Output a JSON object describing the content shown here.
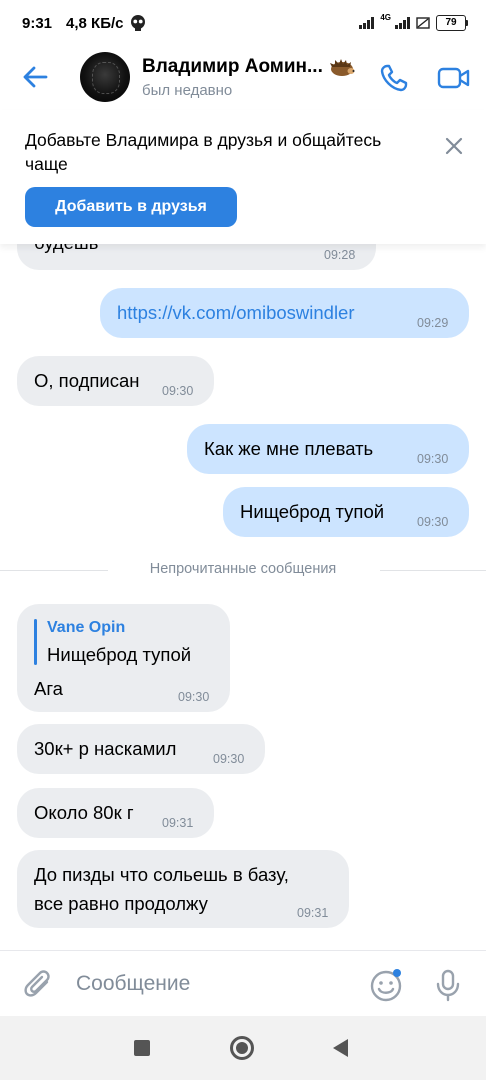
{
  "status_bar": {
    "time": "9:31",
    "speed": "4,8 КБ/с",
    "network": "4G",
    "battery": "79"
  },
  "header": {
    "contact_name": "Владимир Аомин...",
    "contact_status": "был недавно"
  },
  "friend_banner": {
    "text": "Добавьте Владимира в друзья и общайтесь чаще",
    "button_label": "Добавить в друзья"
  },
  "messages": [
    {
      "direction": "in",
      "text": "будешь",
      "time": "09:28"
    },
    {
      "direction": "out",
      "text": "https://vk.com/omiboswindler",
      "time": "09:29",
      "is_link": true
    },
    {
      "direction": "in",
      "text": "О, подписан",
      "time": "09:30"
    },
    {
      "direction": "out",
      "text": "Как же мне плевать",
      "time": "09:30"
    },
    {
      "direction": "out",
      "text": "Нищеброд тупой",
      "time": "09:30"
    }
  ],
  "unread_divider": "Непрочитанные сообщения",
  "unread_messages": [
    {
      "direction": "in",
      "reply_author": "Vane Opin",
      "reply_text": "Нищеброд тупой",
      "text": "Ага",
      "time": "09:30"
    },
    {
      "direction": "in",
      "text": "30к+ р наскамил",
      "time": "09:30"
    },
    {
      "direction": "in",
      "text": "Около 80к г",
      "time": "09:31"
    },
    {
      "direction": "in",
      "text_line1": "До пизды что сольешь в базу,",
      "text_line2": "все равно продолжу",
      "time": "09:31"
    }
  ],
  "input": {
    "placeholder": "Сообщение"
  },
  "colors": {
    "accent": "#2d81e0",
    "incoming_bubble": "#ebedf0",
    "outgoing_bubble": "#cce4ff",
    "secondary_text": "#818c99"
  },
  "icons": {
    "back": "arrow-left-icon",
    "call": "phone-icon",
    "video": "video-camera-icon",
    "close": "close-icon",
    "attach": "paperclip-icon",
    "emoji": "smiley-icon",
    "mic": "microphone-icon",
    "status_extra": "skull-icon",
    "name_badge": "hedgehog-emoji"
  }
}
